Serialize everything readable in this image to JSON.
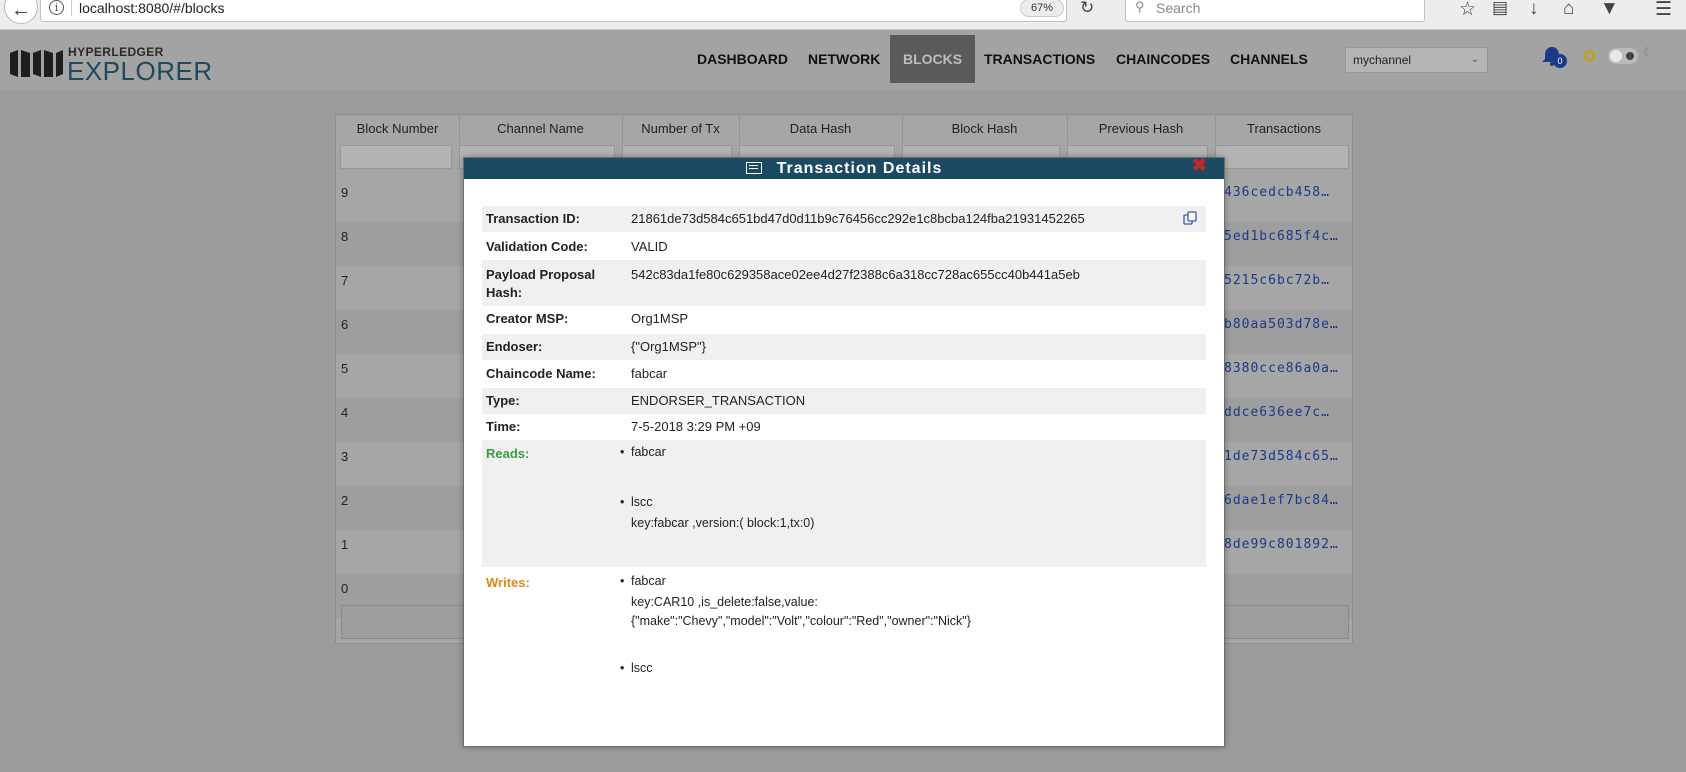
{
  "browser": {
    "url": "localhost:8080/#/blocks",
    "url_host": "localhost",
    "zoom": "67%",
    "search_placeholder": "Search"
  },
  "header": {
    "logo_top": "HYPERLEDGER",
    "logo_bottom": "EXPLORER",
    "nav": [
      "DASHBOARD",
      "NETWORK",
      "BLOCKS",
      "TRANSACTIONS",
      "CHAINCODES",
      "CHANNELS"
    ],
    "active_nav": "BLOCKS",
    "channel": "mychannel",
    "notification_count": "0"
  },
  "table": {
    "columns": [
      "Block Number",
      "Channel Name",
      "Number of Tx",
      "Data Hash",
      "Block Hash",
      "Previous Hash",
      "Transactions"
    ],
    "rows": [
      {
        "block": "9",
        "tx_hash": "436cedcb458…"
      },
      {
        "block": "8",
        "tx_hash": "5ed1bc685f4c…"
      },
      {
        "block": "7",
        "tx_hash": "5215c6bc72b…"
      },
      {
        "block": "6",
        "tx_hash": "b80aa503d78e…"
      },
      {
        "block": "5",
        "tx_hash": "8380cce86a0a…"
      },
      {
        "block": "4",
        "tx_hash": "ddce636ee7c…"
      },
      {
        "block": "3",
        "tx_hash": "1de73d584c65…"
      },
      {
        "block": "2",
        "tx_hash": "6dae1ef7bc84…"
      },
      {
        "block": "1",
        "tx_hash": "8de99c801892…"
      },
      {
        "block": "0",
        "tx_hash": ""
      }
    ]
  },
  "modal": {
    "title": "Transaction Details",
    "close": "✖",
    "fields": {
      "transaction_id_label": "Transaction ID:",
      "transaction_id": "21861de73d584c651bd47d0d11b9c76456cc292e1c8bcba124fba21931452265",
      "validation_code_label": "Validation Code:",
      "validation_code": "VALID",
      "payload_hash_label": "Payload Proposal Hash:",
      "payload_hash": "542c83da1fe80c629358ace02ee4d27f2388c6a318cc728ac655cc40b441a5eb",
      "creator_msp_label": "Creator MSP:",
      "creator_msp": "Org1MSP",
      "endoser_label": "Endoser:",
      "endoser": "{\"Org1MSP\"}",
      "chaincode_label": "Chaincode Name:",
      "chaincode": "fabcar",
      "type_label": "Type:",
      "type": "ENDORSER_TRANSACTION",
      "time_label": "Time:",
      "time": "7-5-2018 3:29 PM +09",
      "reads_label": "Reads:",
      "writes_label": "Writes:"
    },
    "reads": [
      {
        "name": "fabcar",
        "detail": ""
      },
      {
        "name": "lscc",
        "detail": "key:fabcar ,version:( block:1,tx:0)"
      }
    ],
    "writes": [
      {
        "name": "fabcar",
        "detail1": "key:CAR10 ,is_delete:false,value:",
        "detail2": "{\"make\":\"Chevy\",\"model\":\"Volt\",\"colour\":\"Red\",\"owner\":\"Nick\"}"
      },
      {
        "name": "lscc"
      }
    ]
  },
  "colors": {
    "modal_header": "#1d4a63",
    "reads": "#3e9a3e",
    "writes": "#d98a1a",
    "close": "#c0282a"
  }
}
